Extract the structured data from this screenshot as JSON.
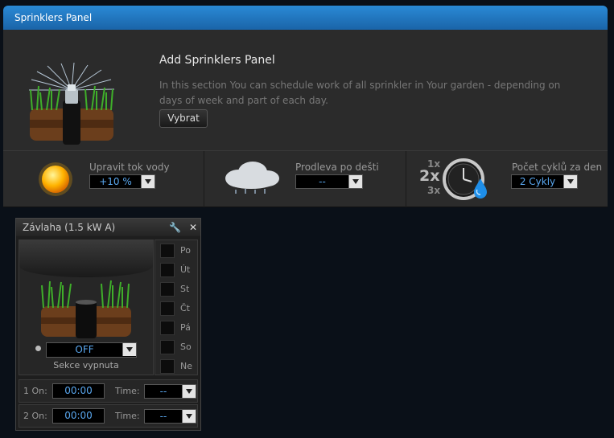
{
  "window": {
    "title": "Sprinklers Panel"
  },
  "intro": {
    "title": "Add Sprinklers Panel",
    "description": "In this section You can schedule work of all sprinkler in Your garden - depending on days of week and part of each day.",
    "button_label": "Vybrat",
    "icon": "sprinkler-icon"
  },
  "controls": {
    "water_flow": {
      "label": "Upravit tok vody",
      "value": "+10 %",
      "icon": "sun-icon"
    },
    "rain_delay": {
      "label": "Prodleva po dešti",
      "value": "--",
      "icon": "rain-cloud-icon"
    },
    "cycles": {
      "label": "Počet cyklů za den",
      "value": "2 Cykly",
      "icon": "clock-water-icon",
      "multipliers": [
        "1x",
        "2x",
        "3x"
      ]
    }
  },
  "zone": {
    "title": "Závlaha (1.5 kW A)",
    "state": "OFF",
    "status": "Sekce vypnuta",
    "days": [
      "Po",
      "Út",
      "St",
      "Čt",
      "Pá",
      "So",
      "Ne"
    ],
    "schedules": [
      {
        "label": "1 On:",
        "time": "00:00",
        "time_label": "Time:",
        "duration": "--"
      },
      {
        "label": "2 On:",
        "time": "00:00",
        "time_label": "Time:",
        "duration": "--"
      }
    ]
  },
  "colors": {
    "accent": "#1f78c4",
    "value_text": "#5aa8f0",
    "panel_bg": "#2b2b2b",
    "page_bg": "#0a1018"
  }
}
